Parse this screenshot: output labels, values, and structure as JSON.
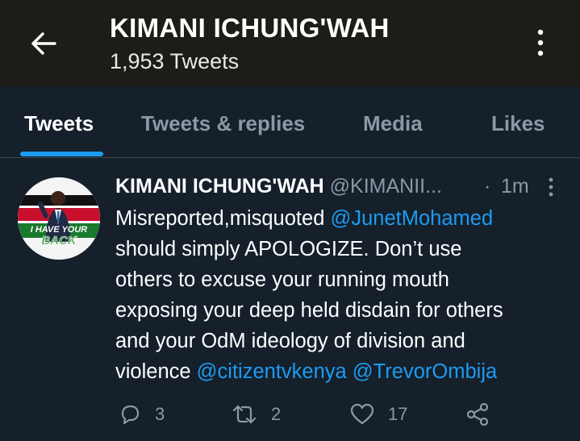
{
  "header": {
    "title": "KIMANI ICHUNG'WAH",
    "subtitle": "1,953 Tweets"
  },
  "tabs": [
    {
      "label": "Tweets",
      "active": true
    },
    {
      "label": "Tweets & replies",
      "active": false
    },
    {
      "label": "Media",
      "active": false
    },
    {
      "label": "Likes",
      "active": false
    }
  ],
  "tweet": {
    "name": "KIMANI ICHUNG'WAH",
    "handle": "@KIMANII...",
    "separator": "·",
    "time": "1m",
    "avatar_text": "I HAVE YOUR BACK",
    "lines": [
      {
        "text": "Misreported,misquoted ",
        "mention": "@JunetMohamed"
      },
      {
        "text": "should simply APOLOGIZE. Don’t use"
      },
      {
        "text": "others to excuse your running mouth"
      },
      {
        "text": "exposing your deep held disdain for others"
      },
      {
        "text": "and your OdM ideology of division and"
      },
      {
        "text": "violence ",
        "mention": "@citizentvkenya",
        "mention2": " @TrevorOmbija"
      }
    ],
    "replies": "3",
    "retweets": "2",
    "likes": "17"
  },
  "colors": {
    "background": "#15202b",
    "header": "#1e1c17",
    "accent": "#1d9bf0",
    "muted": "#8b98a5"
  },
  "icons": [
    "back-arrow-icon",
    "more-vertical-icon",
    "reply-icon",
    "retweet-icon",
    "like-icon",
    "share-icon"
  ]
}
